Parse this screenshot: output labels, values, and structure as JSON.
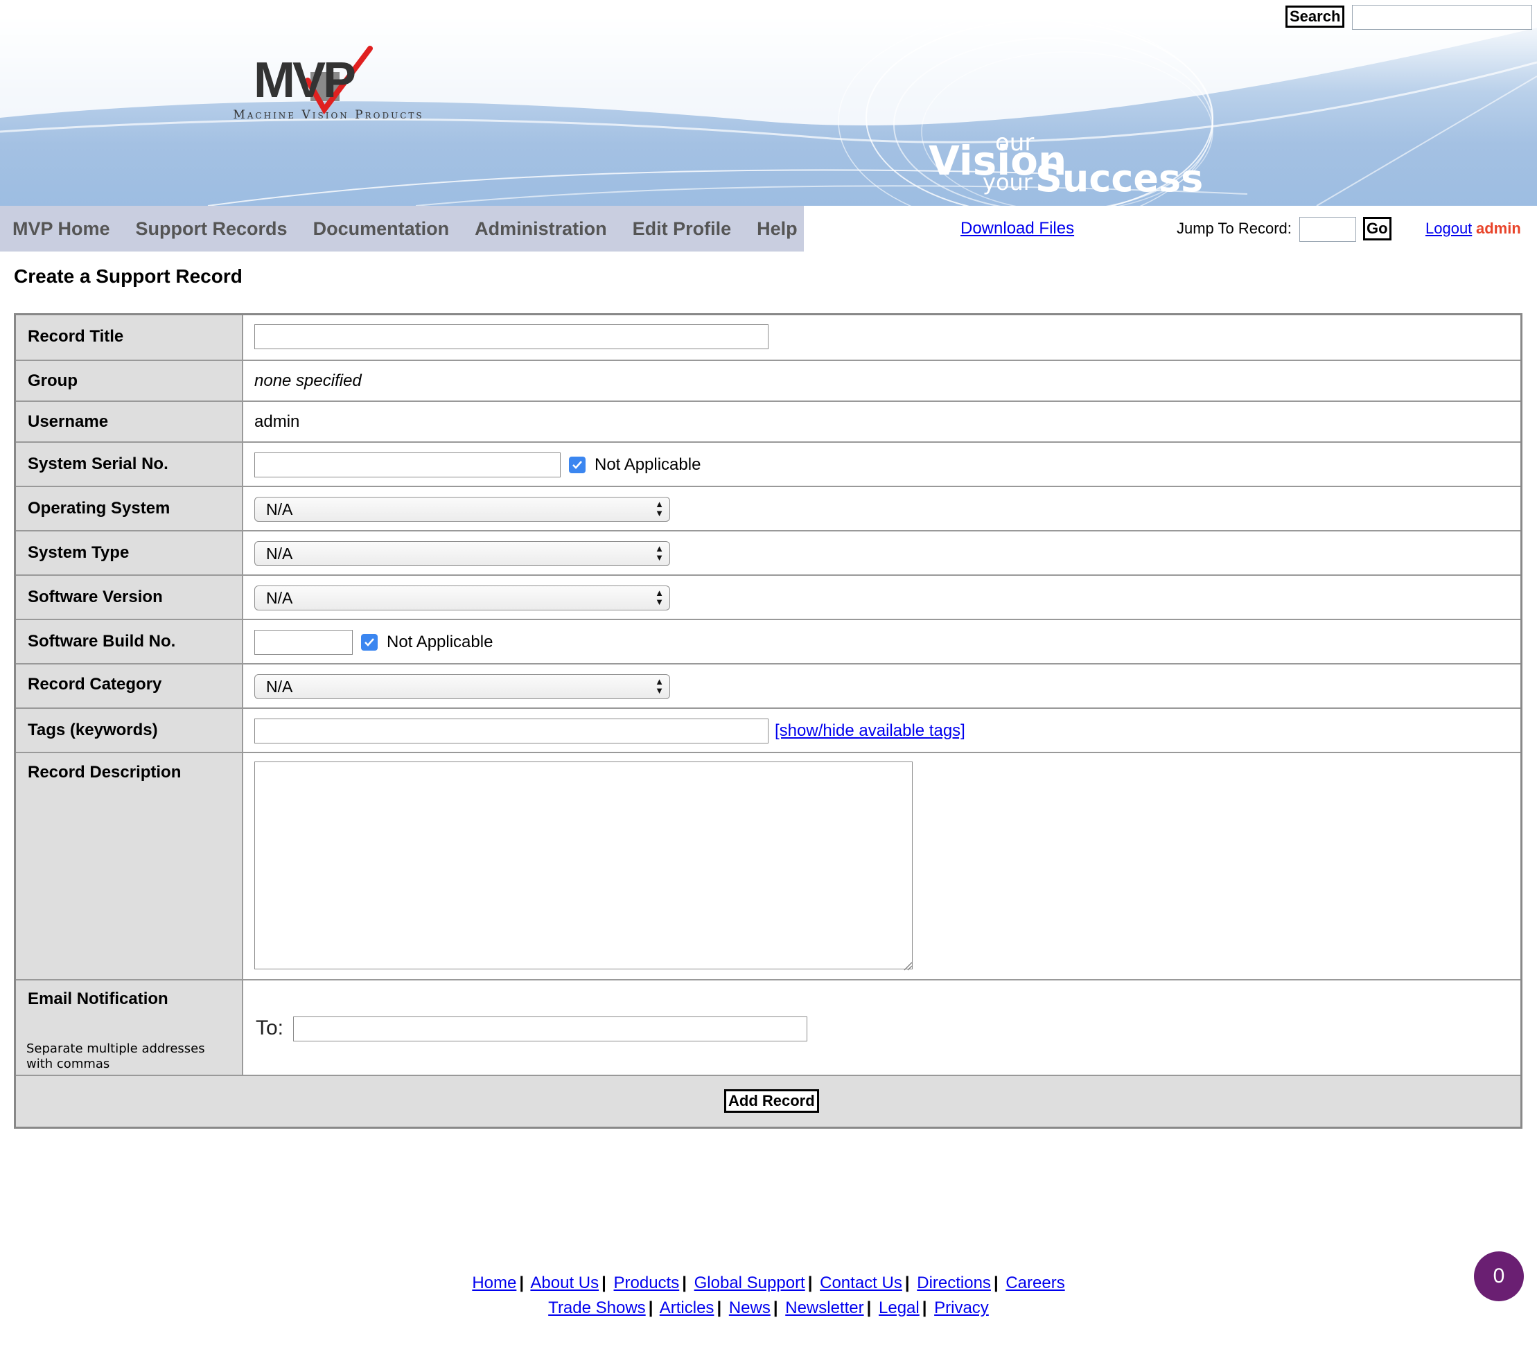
{
  "header": {
    "logo_letters": "MVP",
    "logo_subtitle": "Machine Vision Products",
    "tagline": {
      "our": "our",
      "vision": "Vision",
      "your": "your",
      "success": "Success"
    },
    "search_button": "Search",
    "search_value": ""
  },
  "nav": {
    "items": [
      "MVP Home",
      "Support Records",
      "Documentation",
      "Administration",
      "Edit Profile",
      "Help"
    ],
    "download_files": "Download Files",
    "jump_label": "Jump To Record:",
    "jump_value": "",
    "go_button": "Go",
    "logout_label": "Logout",
    "logout_user": "admin"
  },
  "page": {
    "title": "Create a Support Record"
  },
  "form": {
    "record_title": {
      "label": "Record Title",
      "value": ""
    },
    "group": {
      "label": "Group",
      "value": "none specified"
    },
    "username": {
      "label": "Username",
      "value": "admin"
    },
    "serial": {
      "label": "System Serial No.",
      "value": "",
      "checkbox_label": "Not Applicable",
      "checked": true
    },
    "os": {
      "label": "Operating System",
      "selected": "N/A"
    },
    "system_type": {
      "label": "System Type",
      "selected": "N/A"
    },
    "software_version": {
      "label": "Software Version",
      "selected": "N/A"
    },
    "build": {
      "label": "Software Build No.",
      "value": "",
      "checkbox_label": "Not Applicable",
      "checked": true
    },
    "category": {
      "label": "Record Category",
      "selected": "N/A"
    },
    "tags": {
      "label": "Tags (keywords)",
      "value": "",
      "toggle_link": "[show/hide available tags]"
    },
    "description": {
      "label": "Record Description",
      "value": ""
    },
    "email": {
      "label": "Email Notification",
      "hint": "Separate multiple addresses with commas",
      "to_label": "To:",
      "value": ""
    },
    "submit": "Add Record"
  },
  "footer": {
    "line1": [
      "Home",
      "About Us",
      "Products",
      "Global Support",
      "Contact Us",
      "Directions",
      "Careers"
    ],
    "line2": [
      "Trade Shows",
      "Articles",
      "News",
      "Newsletter",
      "Legal",
      "Privacy"
    ]
  },
  "chat_badge": {
    "count": "0",
    "color": "#6a1f72"
  },
  "colors": {
    "nav_bg": "#c9cee0",
    "link": "#0000ee",
    "user_accent": "#e8442a",
    "label_bg": "#dedede"
  }
}
